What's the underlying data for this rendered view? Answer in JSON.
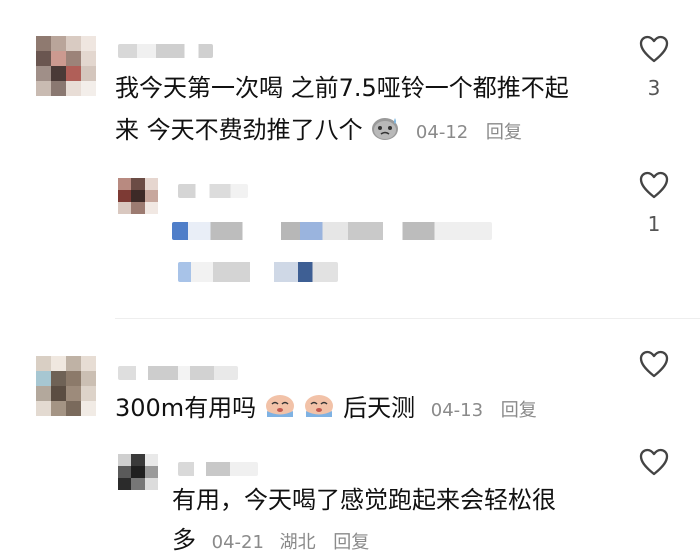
{
  "comments": [
    {
      "text_line1": "我今天第一次喝 之前7.5哑铃一个都推不起",
      "text_line2": "来 今天不费劲推了八个",
      "emoji": "sweat-face-icon",
      "date": "04-12",
      "reply_label": "回复",
      "likes": "3",
      "replies": [
        {
          "likes": "1"
        }
      ]
    },
    {
      "text_prefix": "300m有用吗",
      "text_suffix": "后天测",
      "emoji": "crying-face-icon",
      "date": "04-13",
      "reply_label": "回复",
      "replies": [
        {
          "text_line1": "有用，今天喝了感觉跑起来会轻松很",
          "text_line2": "多",
          "date": "04-21",
          "location": "湖北",
          "reply_label": "回复"
        }
      ]
    }
  ],
  "colors": {
    "text": "#111111",
    "meta": "#8a8a8a",
    "divider": "#eeeeee"
  }
}
